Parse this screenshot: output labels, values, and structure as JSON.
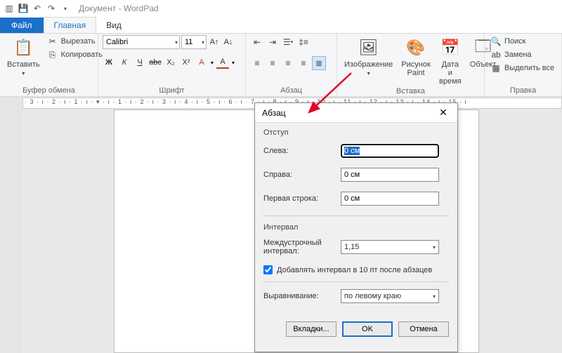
{
  "titlebar": {
    "title": "Документ - WordPad"
  },
  "tabs": {
    "file": "Файл",
    "home": "Главная",
    "view": "Вид"
  },
  "ribbon": {
    "clipboard": {
      "label": "Буфер обмена",
      "paste": "Вставить",
      "cut": "Вырезать",
      "copy": "Копировать"
    },
    "font": {
      "label": "Шрифт",
      "name": "Calibri",
      "size": "11"
    },
    "paragraph": {
      "label": "Абзац"
    },
    "insert": {
      "label": "Вставка",
      "image": "Изображение",
      "paint": "Рисунок Paint",
      "datetime": "Дата и время",
      "object": "Объект"
    },
    "editing": {
      "label": "Правка",
      "find": "Поиск",
      "replace": "Замена",
      "select": "Выделить все"
    }
  },
  "ruler": {
    "marks": "· 3 · ı · 2 · ı · 1 · ı · ▾ · ı · 1 · ı · 2 · ı · 3 · ı · 4 · ı · 5 · ı · 6 · ı · 7 · ı · 8 · ı · 9 · ı · 10 · ı · 11 · ı · 12 · ı · 13 · ı · 14 · ı · 15 · ı"
  },
  "dialog": {
    "title": "Абзац",
    "indent_label": "Отступ",
    "left_label": "Слева:",
    "left_value": "0 см",
    "right_label": "Справа:",
    "right_value": "0 см",
    "first_label": "Первая строка:",
    "first_value": "0 см",
    "interval_label": "Интервал",
    "spacing_label": "Междустрочный интервал:",
    "spacing_value": "1,15",
    "checkbox_label": "Добавлять интервал в 10 пт после абзацев",
    "align_label": "Выравнивание:",
    "align_value": "по левому краю",
    "tabs_btn": "Вкладки...",
    "ok_btn": "OK",
    "cancel_btn": "Отмена"
  }
}
